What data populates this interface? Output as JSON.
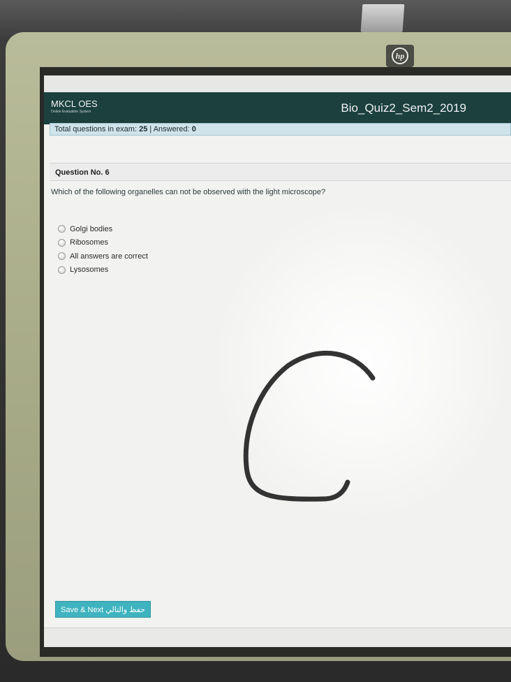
{
  "monitor": {
    "brand_logo": "hp"
  },
  "app": {
    "brand": "MKCL OES",
    "brand_subtitle": "Online Evaluation System",
    "exam_title": "Bio_Quiz2_Sem2_2019"
  },
  "stats": {
    "total_label": "Total questions in exam:",
    "total_value": "25",
    "answered_label": "| Answered:",
    "answered_value": "0"
  },
  "question": {
    "number_label": "Question No. 6",
    "text": "Which of the following organelles can not be observed with the light microscope?",
    "options": [
      {
        "label": "Golgi bodies"
      },
      {
        "label": "Ribosomes"
      },
      {
        "label": "All answers are correct"
      },
      {
        "label": "Lysosomes"
      }
    ]
  },
  "actions": {
    "save_next": "Save & Next حفظ والتالي"
  },
  "annotation": {
    "handwritten_letter": "C"
  },
  "colors": {
    "header": "#1b403d",
    "stats_bar": "#cfe3ea",
    "button": "#3fb3bf",
    "ink": "#333333"
  }
}
